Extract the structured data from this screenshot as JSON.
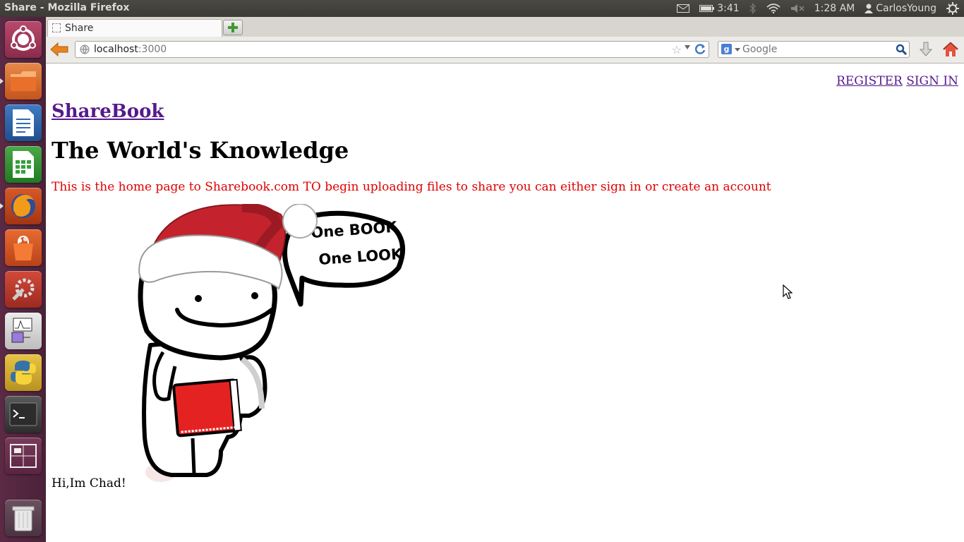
{
  "system_panel": {
    "window_title": "Share - Mozilla Firefox",
    "battery_time": "3:41",
    "clock": "1:28 AM",
    "user": "CarlosYoung"
  },
  "launcher": {
    "items": [
      {
        "icon": "ubuntu-dash-icon"
      },
      {
        "icon": "files-folder-icon"
      },
      {
        "icon": "libreoffice-writer-icon"
      },
      {
        "icon": "libreoffice-calc-icon"
      },
      {
        "icon": "firefox-icon"
      },
      {
        "icon": "software-center-icon"
      },
      {
        "icon": "system-settings-icon"
      },
      {
        "icon": "circuit-app-icon"
      },
      {
        "icon": "python-icon"
      },
      {
        "icon": "terminal-icon"
      },
      {
        "icon": "workspace-switcher-icon"
      },
      {
        "icon": "trash-icon"
      }
    ]
  },
  "browser": {
    "tab_title": "Share",
    "url_host": "localhost",
    "url_port": ":3000",
    "search_placeholder": "Google",
    "search_engine_glyph": "g"
  },
  "page": {
    "nav": {
      "register": "REGISTER",
      "sign_in": "SIGN IN"
    },
    "site_link": "ShareBook",
    "heading": "The World's Knowledge",
    "intro": "This is the home page to Sharebook.com TO begin uploading files to share you can either sign in or create an account",
    "speech_line1": "One BOOK",
    "speech_line2": "One LOOK",
    "caption": "Hi,Im Chad!"
  },
  "colors": {
    "launcher_bg": "#4a2238",
    "panel_bg": "#3c3b37",
    "link": "#551a8b",
    "intro_text": "#e00000",
    "hat_red": "#c4232d"
  }
}
